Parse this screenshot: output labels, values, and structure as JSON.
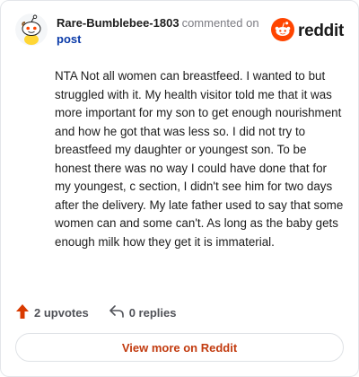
{
  "header": {
    "username": "Rare-Bumblebee-1803",
    "action_text": "commented on",
    "post_link": "post",
    "avatar_icon": "snoo-avatar-icon",
    "brand_icon": "reddit-logo-icon",
    "brand_text": "reddit",
    "brand_color": "#ff4500"
  },
  "comment": {
    "body": "NTA Not all women can breastfeed. I wanted to but struggled with it. My health visitor told me that it was more important for my son to get enough nourishment and how he got that was less so. I did not try to breastfeed my daughter or youngest son. To be honest there was no way I could have done that for my youngest, c section, I didn't see him for two days after the delivery. My late father used to say that some women can and some can't. As long as the baby gets enough milk how they get it is immaterial."
  },
  "footer": {
    "upvotes_label": "2 upvotes",
    "replies_label": "0 replies",
    "upvote_icon": "upvote-arrow-icon",
    "reply_icon": "reply-arrow-icon",
    "upvote_color": "#d93a00",
    "view_more_label": "View more on Reddit"
  }
}
